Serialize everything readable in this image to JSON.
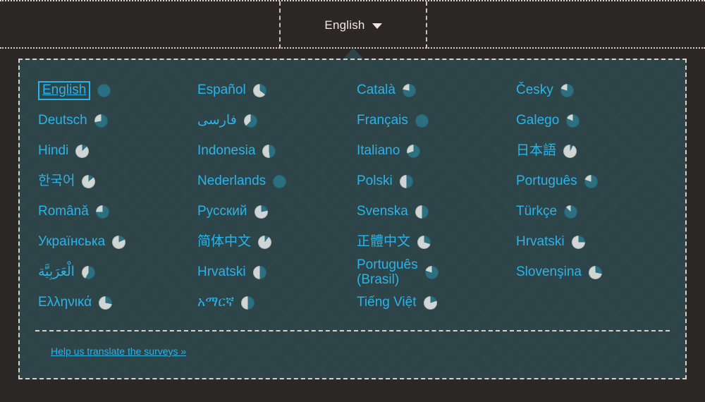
{
  "topbar": {
    "current_language": "English",
    "caret_icon": "chevron-down-icon"
  },
  "panel": {
    "footer_link": "Help us translate the surveys »",
    "background_color": "#2d4448",
    "link_color": "#2bb3e8",
    "pie_done_color": "#cfd6d3",
    "pie_remaining_color": "#2b6f80"
  },
  "languages": [
    {
      "label": "English",
      "percent": 100,
      "current": true
    },
    {
      "label": "Español",
      "percent": 35,
      "current": false
    },
    {
      "label": "Català",
      "percent": 78,
      "current": false
    },
    {
      "label": "Česky",
      "percent": 80,
      "current": false
    },
    {
      "label": "Deutsch",
      "percent": 72,
      "current": false
    },
    {
      "label": "فارسی",
      "percent": 62,
      "current": false
    },
    {
      "label": "Français",
      "percent": 100,
      "current": false
    },
    {
      "label": "Galego",
      "percent": 82,
      "current": false
    },
    {
      "label": "Hindi",
      "percent": 12,
      "current": false
    },
    {
      "label": "Indonesia",
      "percent": 48,
      "current": false
    },
    {
      "label": "Italiano",
      "percent": 70,
      "current": false
    },
    {
      "label": "日本語",
      "percent": 8,
      "current": false
    },
    {
      "label": "한국어",
      "percent": 14,
      "current": false
    },
    {
      "label": "Nederlands",
      "percent": 100,
      "current": false
    },
    {
      "label": "Polski",
      "percent": 50,
      "current": false
    },
    {
      "label": "Português",
      "percent": 80,
      "current": false
    },
    {
      "label": "Română",
      "percent": 75,
      "current": false
    },
    {
      "label": "Русский",
      "percent": 22,
      "current": false
    },
    {
      "label": "Svenska",
      "percent": 50,
      "current": false
    },
    {
      "label": "Türkçe",
      "percent": 88,
      "current": false
    },
    {
      "label": "Українська",
      "percent": 18,
      "current": false
    },
    {
      "label": "简体中文",
      "percent": 10,
      "current": false
    },
    {
      "label": "正體中文",
      "percent": 30,
      "current": false
    },
    {
      "label": "Hrvatski",
      "percent": 25,
      "current": false
    },
    {
      "label": "الْعَرَبِيَّة",
      "percent": 58,
      "current": false
    },
    {
      "label": "Hrvatski",
      "percent": 50,
      "current": false
    },
    {
      "label": "Português\n(Brasil)",
      "percent": 80,
      "current": false
    },
    {
      "label": "Slovenşina",
      "percent": 28,
      "current": false
    },
    {
      "label": "Ελληνικά",
      "percent": 28,
      "current": false
    },
    {
      "label": "አማርኛ",
      "percent": 50,
      "current": false
    },
    {
      "label": "Tiếng Việt",
      "percent": 20,
      "current": false
    }
  ]
}
